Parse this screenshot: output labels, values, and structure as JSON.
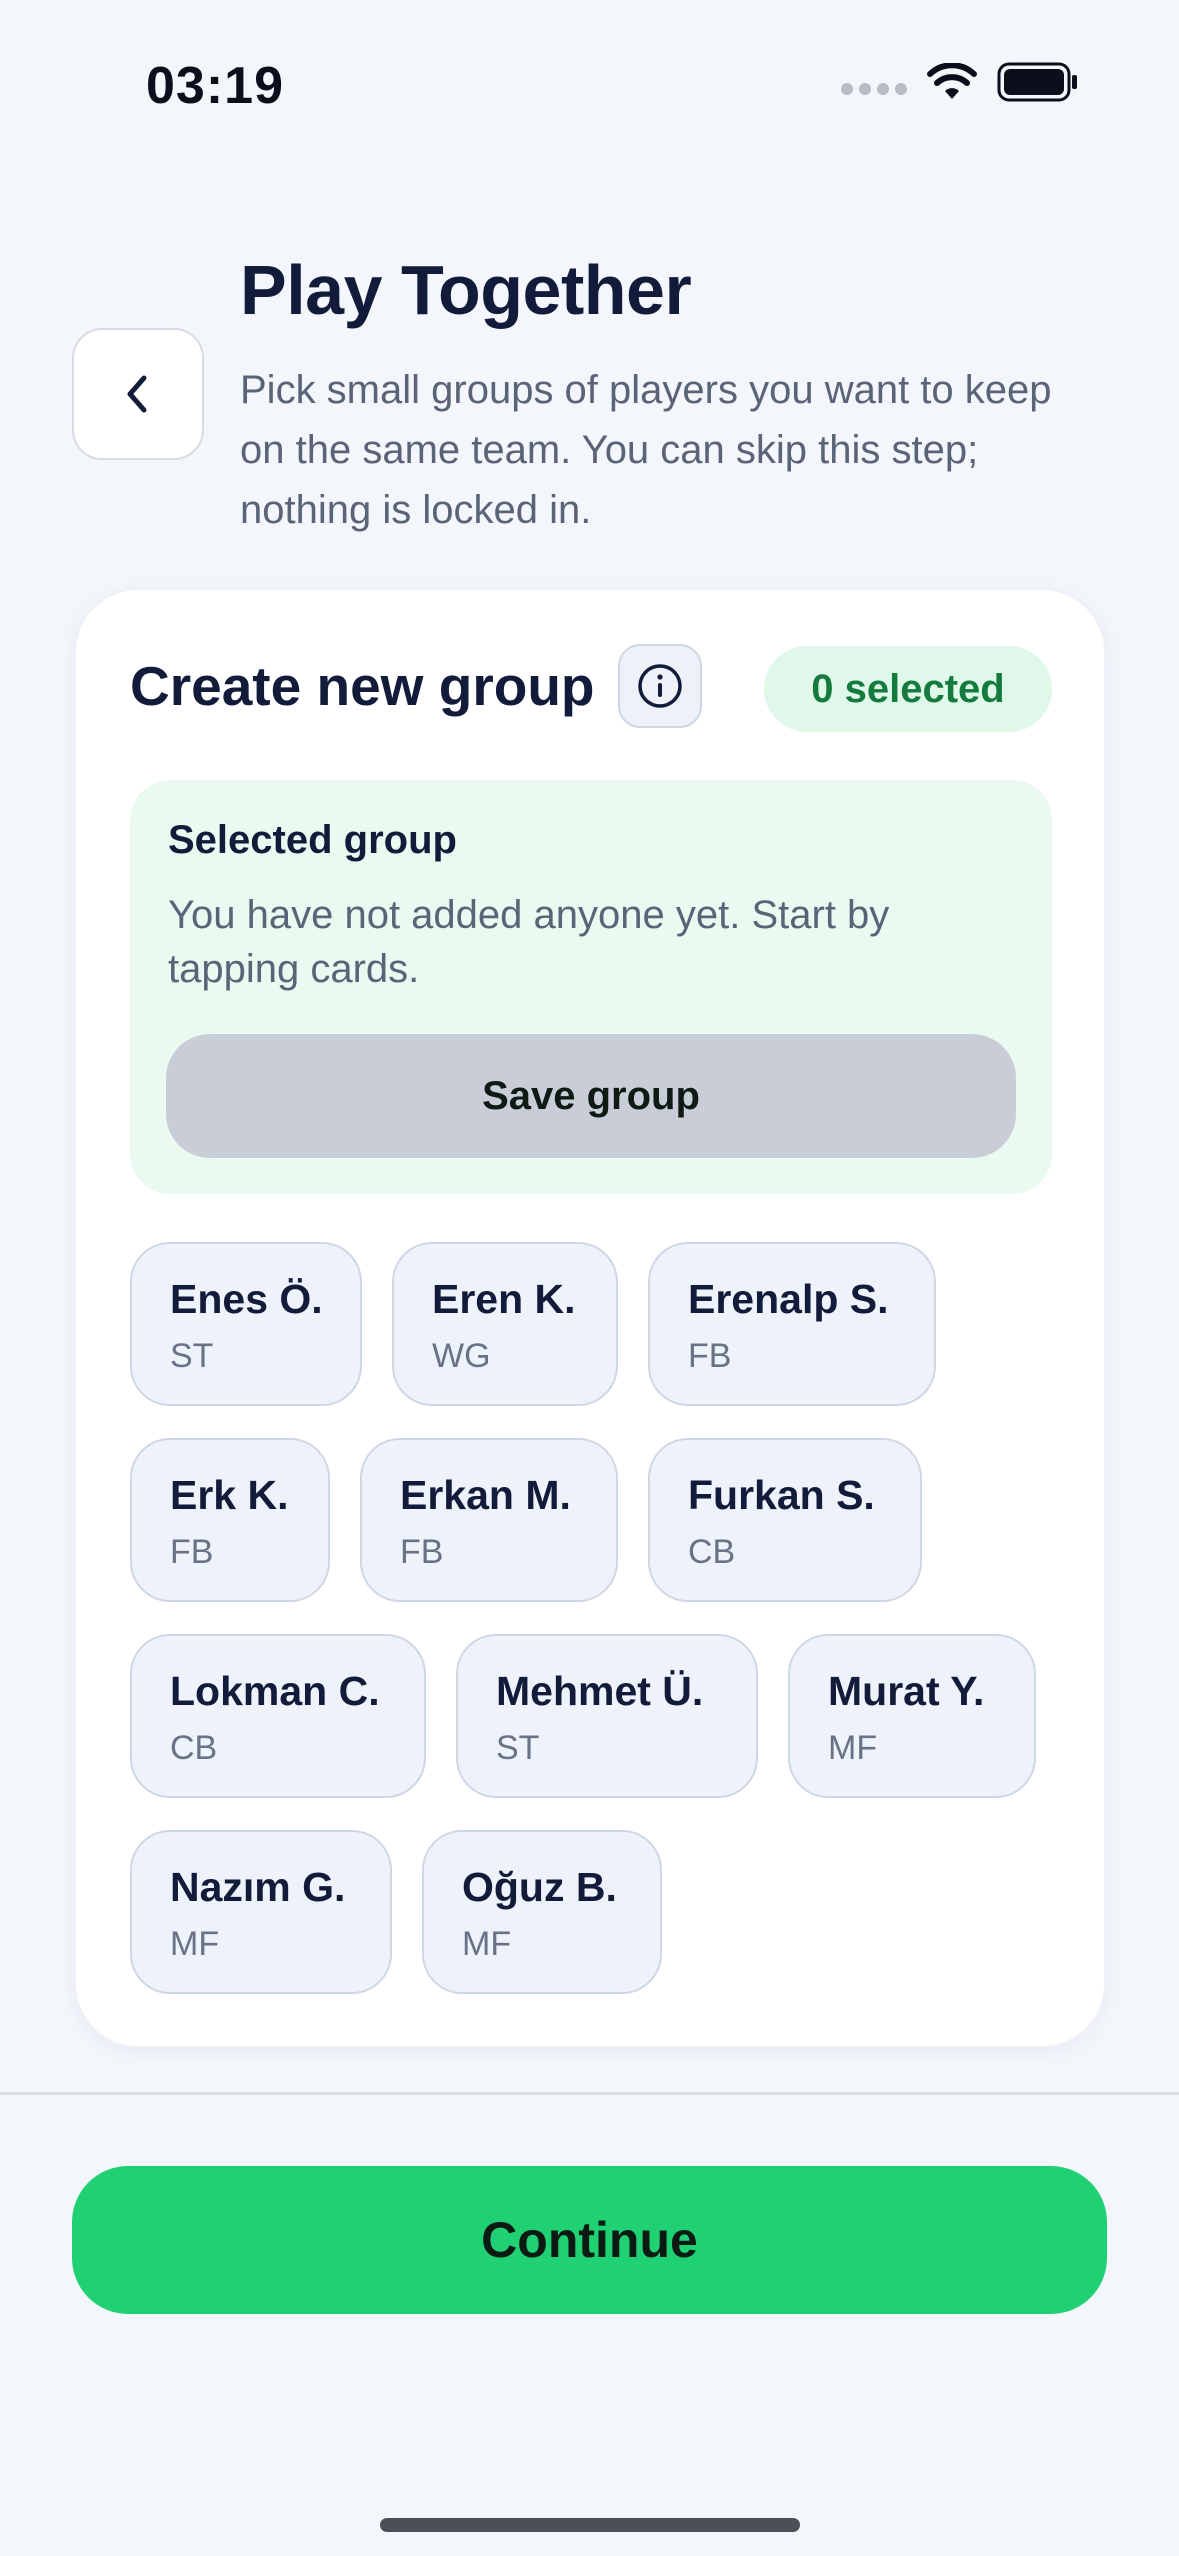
{
  "status_bar": {
    "time": "03:19"
  },
  "header": {
    "title": "Play Together",
    "subtitle": "Pick small groups of players you want to keep on the same team. You can skip this step; nothing is locked in."
  },
  "card": {
    "title": "Create new group",
    "selected_count": "0 selected",
    "group": {
      "heading": "Selected group",
      "empty_text": "You have not added anyone yet. Start by tapping cards.",
      "save_label": "Save group"
    },
    "players": [
      [
        {
          "name": "Enes Ö.",
          "position": "ST"
        },
        {
          "name": "Eren K.",
          "position": "WG"
        },
        {
          "name": "Erenalp S.",
          "position": "FB"
        }
      ],
      [
        {
          "name": "Erk K.",
          "position": "FB"
        },
        {
          "name": "Erkan M.",
          "position": "FB"
        },
        {
          "name": "Furkan S.",
          "position": "CB"
        }
      ],
      [
        {
          "name": "Lokman C.",
          "position": "CB"
        },
        {
          "name": "Mehmet Ü.",
          "position": "ST"
        },
        {
          "name": "Murat Y.",
          "position": "MF"
        }
      ],
      [
        {
          "name": "Nazım G.",
          "position": "MF"
        },
        {
          "name": "Oğuz B.",
          "position": "MF"
        }
      ]
    ]
  },
  "footer": {
    "continue_label": "Continue"
  },
  "colors": {
    "accent_green": "#20d174",
    "badge_bg": "#dff8e9",
    "badge_text": "#147a3d",
    "group_bg": "#ebfaf1",
    "save_disabled": "#c8cdd8",
    "chip_bg": "#eef2fa"
  },
  "icons": {
    "back": "chevron-left-icon",
    "info": "info-circle-icon",
    "signal": "cellular-signal-icon",
    "wifi": "wifi-icon",
    "battery": "battery-icon"
  }
}
